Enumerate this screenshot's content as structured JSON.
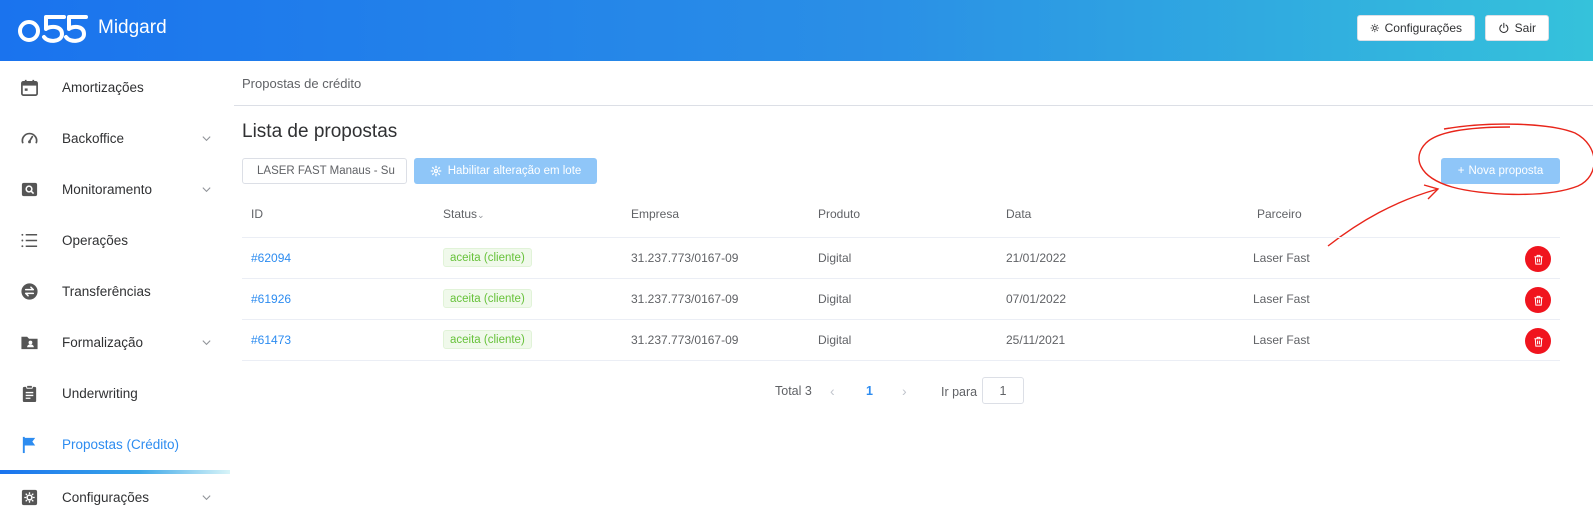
{
  "header": {
    "brand": "Midgard",
    "logo_text": "o55",
    "settings_label": "Configurações",
    "logout_label": "Sair"
  },
  "sidebar": {
    "items": [
      {
        "label": "Amortizações",
        "icon": "calendar-icon",
        "expandable": false
      },
      {
        "label": "Backoffice",
        "icon": "gauge-icon",
        "expandable": true
      },
      {
        "label": "Monitoramento",
        "icon": "search-box-icon",
        "expandable": true
      },
      {
        "label": "Operações",
        "icon": "list-icon",
        "expandable": false
      },
      {
        "label": "Transferências",
        "icon": "swap-icon",
        "expandable": false
      },
      {
        "label": "Formalização",
        "icon": "folder-user-icon",
        "expandable": true
      },
      {
        "label": "Underwriting",
        "icon": "clipboard-icon",
        "expandable": false
      },
      {
        "label": "Propostas (Crédito)",
        "icon": "flag-icon",
        "expandable": false,
        "active": true
      },
      {
        "label": "Configurações",
        "icon": "cog-box-icon",
        "expandable": true
      }
    ]
  },
  "main": {
    "breadcrumb": "Propostas de crédito",
    "title": "Lista de propostas",
    "filter_value": "LASER FAST Manaus - Su",
    "batch_button": "Habilitar alteração em lote",
    "new_button": "Nova proposta",
    "columns": [
      "ID",
      "Status",
      "Empresa",
      "Produto",
      "Data",
      "Parceiro"
    ],
    "rows": [
      {
        "id": "#62094",
        "status": "aceita (cliente)",
        "empresa": "31.237.773/0167-09",
        "produto": "Digital",
        "data": "21/01/2022",
        "parceiro": "Laser Fast"
      },
      {
        "id": "#61926",
        "status": "aceita (cliente)",
        "empresa": "31.237.773/0167-09",
        "produto": "Digital",
        "data": "07/01/2022",
        "parceiro": "Laser Fast"
      },
      {
        "id": "#61473",
        "status": "aceita (cliente)",
        "empresa": "31.237.773/0167-09",
        "produto": "Digital",
        "data": "25/11/2021",
        "parceiro": "Laser Fast"
      }
    ],
    "pagination": {
      "total": "Total 3",
      "current_page": "1",
      "goto_label": "Ir para",
      "goto_value": "1"
    }
  },
  "colors": {
    "accent": "#2d8cf0",
    "danger": "#f0141e",
    "success": "#67c23a",
    "annotation": "#e8251a"
  }
}
